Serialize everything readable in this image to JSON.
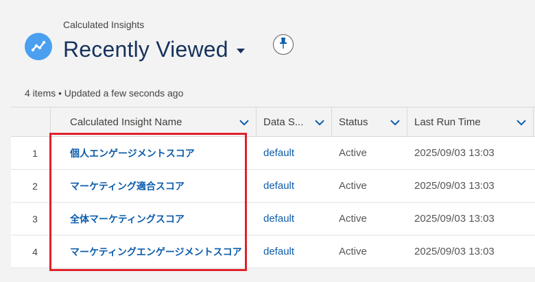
{
  "header": {
    "object_label": "Calculated Insights",
    "title": "Recently Viewed"
  },
  "meta": {
    "summary": "4 items • Updated a few seconds ago"
  },
  "table": {
    "columns": [
      {
        "label": "Calculated Insight Name"
      },
      {
        "label": "Data S..."
      },
      {
        "label": "Status"
      },
      {
        "label": "Last Run Time"
      }
    ],
    "rows": [
      {
        "num": "1",
        "name": "個人エンゲージメントスコア",
        "data_space": "default",
        "status": "Active",
        "last_run": "2025/09/03 13:03"
      },
      {
        "num": "2",
        "name": "マーケティング適合スコア",
        "data_space": "default",
        "status": "Active",
        "last_run": "2025/09/03 13:03"
      },
      {
        "num": "3",
        "name": "全体マーケティングスコア",
        "data_space": "default",
        "status": "Active",
        "last_run": "2025/09/03 13:03"
      },
      {
        "num": "4",
        "name": "マーケティングエンゲージメントスコア",
        "data_space": "default",
        "status": "Active",
        "last_run": "2025/09/03 13:03"
      }
    ]
  },
  "colors": {
    "accent": "#0b5cab",
    "app_icon": "#4a9fef",
    "highlight": "#e0202a"
  },
  "icons": {
    "app": "trend-line-icon",
    "title_caret": "caret-down-icon",
    "pin": "pin-icon",
    "column_menu": "chevron-down-icon"
  }
}
